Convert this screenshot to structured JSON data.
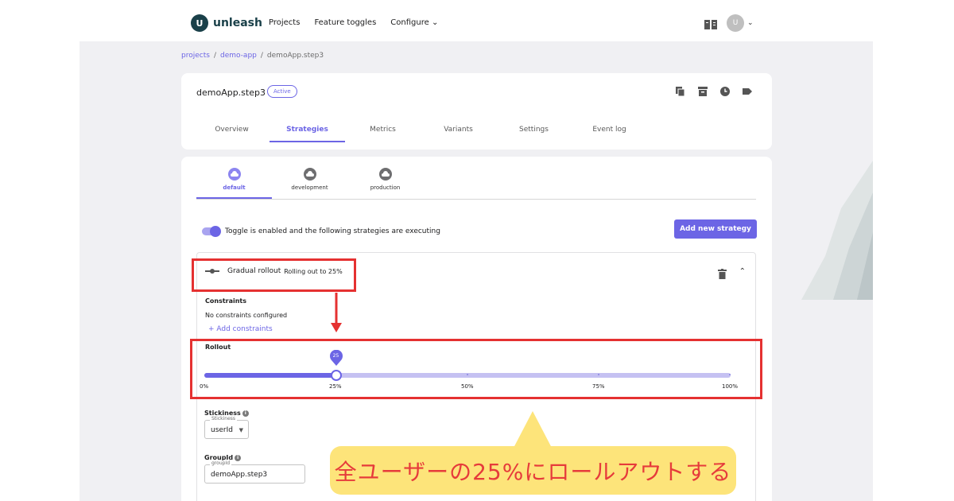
{
  "nav": {
    "logo_text": "unleash",
    "logo_letter": "U",
    "links": [
      "Projects",
      "Feature toggles",
      "Configure"
    ],
    "avatar_letter": "U"
  },
  "breadcrumb": {
    "items": [
      "projects",
      "demo-app",
      "demoApp.step3"
    ],
    "separator": "/"
  },
  "feature": {
    "name": "demoApp.step3",
    "status": "Active",
    "tabs": [
      "Overview",
      "Strategies",
      "Metrics",
      "Variants",
      "Settings",
      "Event log"
    ],
    "active_tab": "Strategies"
  },
  "environments": {
    "tabs": [
      "default",
      "development",
      "production"
    ],
    "active": "default"
  },
  "toggle_text": "Toggle is enabled and the following strategies are executing",
  "add_strategy_label": "Add new strategy",
  "strategy": {
    "name": "Gradual rollout",
    "description": "Rolling out to 25%",
    "constraints_title": "Constraints",
    "constraints_text": "No constraints configured",
    "add_constraints": "+ Add constraints",
    "rollout_title": "Rollout",
    "rollout_percent": 25,
    "rollout_value_label": "25",
    "marks": [
      "0%",
      "25%",
      "50%",
      "75%",
      "100%"
    ],
    "stickiness_title": "Stickiness",
    "stickiness_legend": "Stickiness",
    "stickiness_value": "userId",
    "groupid_title": "GroupId",
    "groupid_legend": "groupId",
    "groupid_value": "demoApp.step3"
  },
  "annotation": {
    "callout_text": "全ユーザーの25%にロールアウトする",
    "color_box": "#e53131",
    "color_callout_bg": "#fde47a",
    "color_callout_text": "#e63b3b"
  },
  "colors": {
    "accent": "#6c65e5",
    "logo": "#1a4049",
    "background": "#f0f0f3"
  },
  "icons": [
    "unleash-logo-icon",
    "docs-book-icon",
    "chevron-down-icon",
    "copy-icon",
    "archive-icon",
    "history-icon",
    "tag-icon",
    "cloud-icon",
    "slider-strategy-icon",
    "trash-icon",
    "chevron-up-icon",
    "info-icon"
  ]
}
